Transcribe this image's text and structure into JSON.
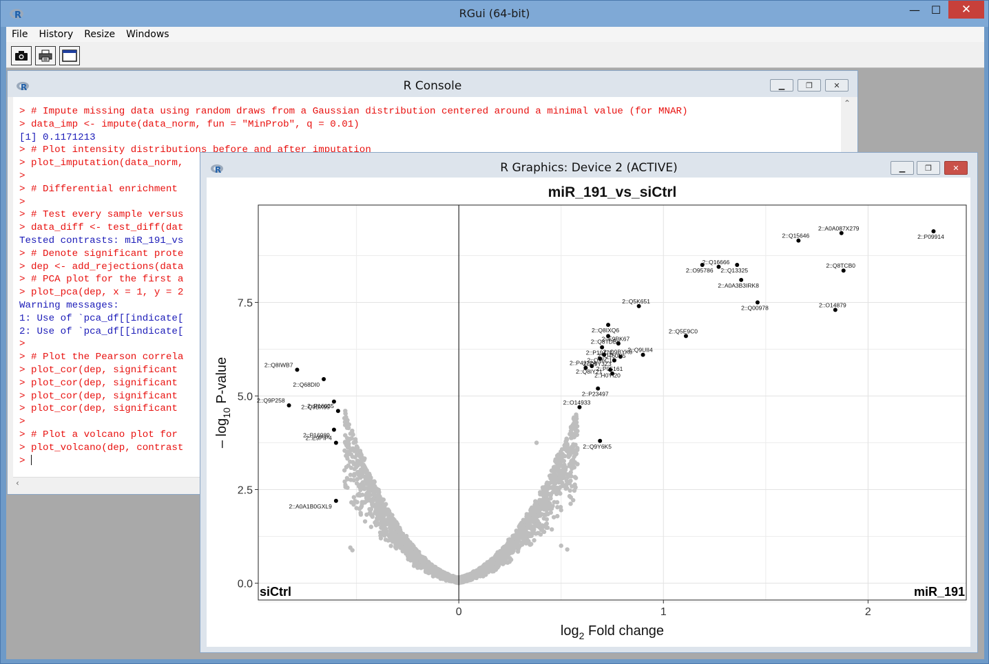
{
  "window": {
    "title": "RGui (64-bit)",
    "min_glyph": "—",
    "max_glyph": "☐",
    "close_glyph": "✕"
  },
  "menu": [
    {
      "label": "File"
    },
    {
      "label": "History"
    },
    {
      "label": "Resize"
    },
    {
      "label": "Windows"
    }
  ],
  "toolbar": [
    {
      "icon": "camera-icon"
    },
    {
      "icon": "printer-icon"
    },
    {
      "icon": "window-icon"
    }
  ],
  "console": {
    "title": "R Console",
    "lines": [
      {
        "text": "> # Impute missing data using random draws from a Gaussian distribution centered around a minimal value (for MNAR)",
        "type": "cmd"
      },
      {
        "text": "> data_imp <- impute(data_norm, fun = \"MinProb\", q = 0.01)",
        "type": "cmd"
      },
      {
        "text": "[1] 0.1171213",
        "type": "out"
      },
      {
        "text": "> # Plot intensity distributions before and after imputation",
        "type": "cmd"
      },
      {
        "text": "> plot_imputation(data_norm,",
        "type": "cmd"
      },
      {
        "text": ">",
        "type": "cmd"
      },
      {
        "text": "> # Differential enrichment",
        "type": "cmd"
      },
      {
        "text": ">",
        "type": "cmd"
      },
      {
        "text": "> # Test every sample versus",
        "type": "cmd"
      },
      {
        "text": "> data_diff <- test_diff(dat",
        "type": "cmd"
      },
      {
        "text": "Tested contrasts: miR_191_vs",
        "type": "out"
      },
      {
        "text": "> # Denote significant prote",
        "type": "cmd"
      },
      {
        "text": "> dep <- add_rejections(data",
        "type": "cmd"
      },
      {
        "text": "> # PCA plot for the first a",
        "type": "cmd"
      },
      {
        "text": "> plot_pca(dep, x = 1, y = 2",
        "type": "cmd"
      },
      {
        "text": "Warning messages:",
        "type": "out"
      },
      {
        "text": "1: Use of `pca_df[[indicate[",
        "type": "out"
      },
      {
        "text": "2: Use of `pca_df[[indicate[",
        "type": "out"
      },
      {
        "text": ">",
        "type": "cmd"
      },
      {
        "text": "> # Plot the Pearson correla",
        "type": "cmd"
      },
      {
        "text": "> plot_cor(dep, significant",
        "type": "cmd"
      },
      {
        "text": "> plot_cor(dep, significant",
        "type": "cmd"
      },
      {
        "text": "> plot_cor(dep, significant",
        "type": "cmd"
      },
      {
        "text": "> plot_cor(dep, significant",
        "type": "cmd"
      },
      {
        "text": ">",
        "type": "cmd"
      },
      {
        "text": "> # Plot a volcano plot for",
        "type": "cmd"
      },
      {
        "text": "> plot_volcano(dep, contrast",
        "type": "cmd"
      },
      {
        "text": "> ",
        "type": "cmd"
      }
    ]
  },
  "graphics": {
    "title": "R Graphics: Device 2 (ACTIVE)"
  },
  "chart_data": {
    "type": "scatter",
    "title": "miR_191_vs_siCtrl",
    "xlabel_main": "log",
    "xlabel_sub": "2",
    "xlabel_rest": " Fold change",
    "ylabel_prefix": "– log",
    "ylabel_sub": "10",
    "ylabel_rest": " P-value",
    "xlim": [
      -0.98,
      2.48
    ],
    "ylim": [
      -0.45,
      10.1
    ],
    "x_ticks": [
      {
        "v": 0,
        "label": "0"
      },
      {
        "v": 1,
        "label": "1"
      },
      {
        "v": 2,
        "label": "2"
      }
    ],
    "y_ticks": [
      {
        "v": 0,
        "label": "0.0"
      },
      {
        "v": 2.5,
        "label": "2.5"
      },
      {
        "v": 5,
        "label": "5.0"
      },
      {
        "v": 7.5,
        "label": "7.5"
      }
    ],
    "corner_left": "siCtrl",
    "corner_right": "miR_191",
    "vline_x": 0,
    "background_cloud_color": "#bebebe",
    "significant_color": "#000000",
    "significant": [
      {
        "label": "2::A0A087X279",
        "x": 1.87,
        "y": 9.35
      },
      {
        "label": "2::P09914",
        "x": 2.32,
        "y": 9.4
      },
      {
        "label": "2::Q15646",
        "x": 1.66,
        "y": 9.15
      },
      {
        "label": "2::O95786",
        "x": 1.19,
        "y": 8.5
      },
      {
        "label": "2::Q16666",
        "x": 1.27,
        "y": 8.45
      },
      {
        "label": "2::Q13325",
        "x": 1.36,
        "y": 8.5
      },
      {
        "label": "2::Q8TCB0",
        "x": 1.88,
        "y": 8.35
      },
      {
        "label": "2::A0A3B3IRK8",
        "x": 1.38,
        "y": 8.1
      },
      {
        "label": "2::Q5K651",
        "x": 0.88,
        "y": 7.4
      },
      {
        "label": "2::Q00978",
        "x": 1.46,
        "y": 7.5
      },
      {
        "label": "2::O14879",
        "x": 1.84,
        "y": 7.3
      },
      {
        "label": "2::Q8IXQ6",
        "x": 0.73,
        "y": 6.9
      },
      {
        "label": "2::Q5E9C0",
        "x": 1.11,
        "y": 6.6
      },
      {
        "label": "2::Q8TDB6",
        "x": 0.73,
        "y": 6.6
      },
      {
        "label": "2::E9PK67",
        "x": 0.78,
        "y": 6.4
      },
      {
        "label": "2::P19474",
        "x": 0.7,
        "y": 6.3
      },
      {
        "label": "2::Q9UII4",
        "x": 0.9,
        "y": 6.1
      },
      {
        "label": "2::Q96C10",
        "x": 0.71,
        "y": 6.1
      },
      {
        "label": "2::Q9BYK8",
        "x": 0.79,
        "y": 6.05
      },
      {
        "label": "2::Q9Y3Z3",
        "x": 0.69,
        "y": 6.0
      },
      {
        "label": "2::Q460N5",
        "x": 0.76,
        "y": 5.95
      },
      {
        "label": "2::Q8IY21",
        "x": 0.65,
        "y": 5.8
      },
      {
        "label": "2::P42224",
        "x": 0.62,
        "y": 5.75
      },
      {
        "label": "2::H0YI20",
        "x": 0.74,
        "y": 5.7
      },
      {
        "label": "2::P05161",
        "x": 0.75,
        "y": 5.6
      },
      {
        "label": "2::P23497",
        "x": 0.68,
        "y": 5.2
      },
      {
        "label": "2::O14933",
        "x": 0.59,
        "y": 4.7
      },
      {
        "label": "2::Q9Y6K5",
        "x": 0.69,
        "y": 3.8
      },
      {
        "label": "2::Q8IWB7",
        "x": -0.79,
        "y": 5.7
      },
      {
        "label": "2::Q68DI0",
        "x": -0.66,
        "y": 5.45
      },
      {
        "label": "2::Q9P258",
        "x": -0.83,
        "y": 4.75
      },
      {
        "label": "2::Q9BX95",
        "x": -0.61,
        "y": 4.85
      },
      {
        "label": "2::P16035",
        "x": -0.59,
        "y": 4.6
      },
      {
        "label": "2::P16989",
        "x": -0.61,
        "y": 4.1
      },
      {
        "label": "2::E9PIP4",
        "x": -0.6,
        "y": 3.75
      },
      {
        "label": "2::A0A1B0GXL9",
        "x": -0.6,
        "y": 2.2
      }
    ]
  }
}
